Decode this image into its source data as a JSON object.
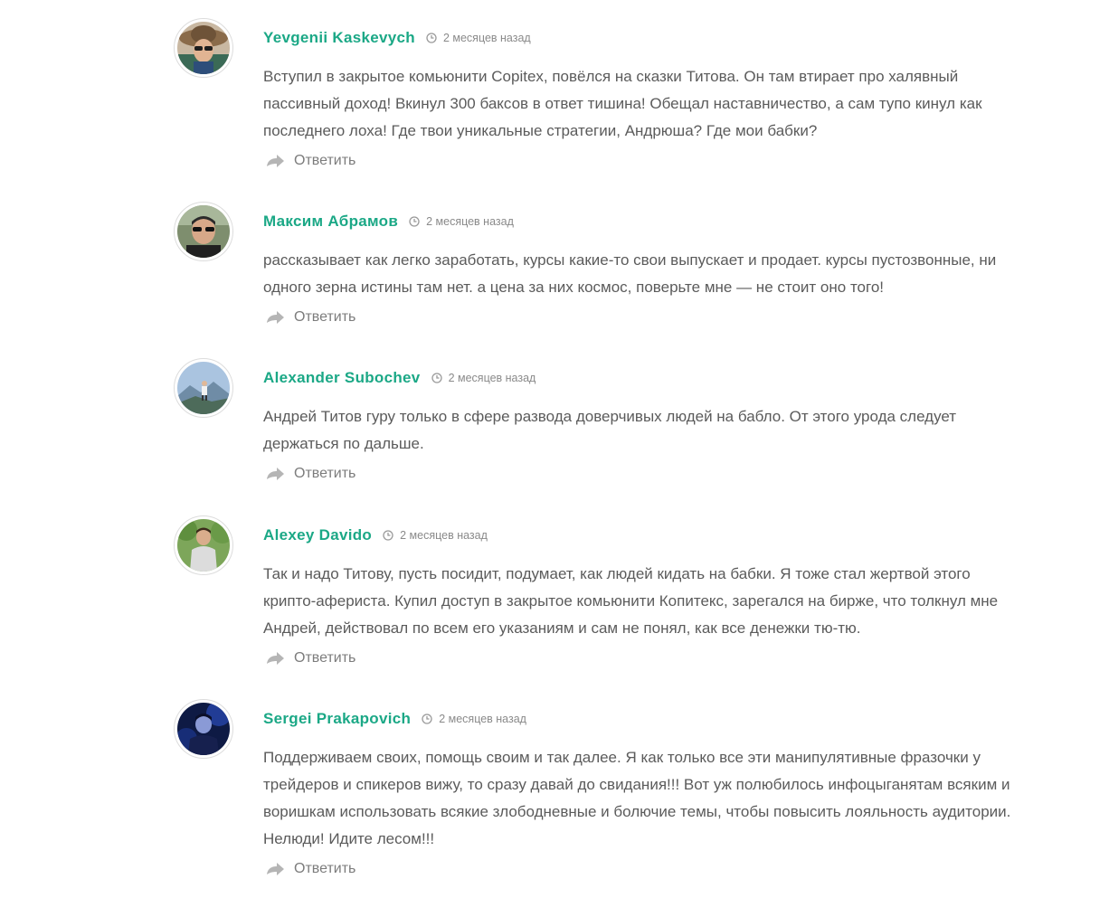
{
  "comments": [
    {
      "author": "Yevgenii Kaskevych",
      "date": "2 месяцев назад",
      "text": "Вступил в закрытое комьюнити Copitex, повёлся на сказки Титова. Он там втирает про халявный пассивный доход! Вкинул 300 баксов в ответ тишина! Обещал наставничество, а сам тупо кинул как последнего лоха! Где твои уникальные стратегии, Андрюша? Где мои бабки?",
      "reply_label": "Ответить",
      "avatar_icon": "avatar-man-hat-sunglasses"
    },
    {
      "author": "Максим Абрамов",
      "date": "2 месяцев назад",
      "text": "рассказывает как легко заработать, курсы какие-то свои выпускает и продает. курсы пустозвонные, ни одного зерна истины там нет. а цена за них космос, поверьте мне — не стоит оно того!",
      "reply_label": "Ответить",
      "avatar_icon": "avatar-man-sunglasses"
    },
    {
      "author": "Alexander Subochev",
      "date": "2 месяцев назад",
      "text": "Андрей Титов гуру только в сфере развода доверчивых людей на бабло. От этого урода следует держаться по дальше.",
      "reply_label": "Ответить",
      "avatar_icon": "avatar-person-mountains"
    },
    {
      "author": "Alexey Davido",
      "date": "2 месяцев назад",
      "text": "Так и надо Титову, пусть посидит, подумает, как людей кидать на бабки. Я тоже стал жертвой этого крипто-афериста. Купил доступ в закрытое комьюнити Копитекс, зарегался на бирже, что толкнул мне Андрей, действовал по всем его указаниям и сам не понял, как все денежки тю-тю.",
      "reply_label": "Ответить",
      "avatar_icon": "avatar-man-greenery"
    },
    {
      "author": "Sergei Prakapovich",
      "date": "2 месяцев назад",
      "text": "Поддерживаем своих, помощь своим и так далее. Я как только все эти манипулятивные фразочки у трейдеров и спикеров вижу, то сразу давай до свидания!!! Вот уж полюбилось инфоцыганятам всяким и воришкам использовать всякие злободневные и болючие темы, чтобы повысить лояльность аудитории. Нелюди! Идите лесом!!!",
      "reply_label": "Ответить",
      "avatar_icon": "avatar-man-blue-light"
    }
  ],
  "colors": {
    "author": "#1ba886",
    "text": "#5b5b5b",
    "meta": "#8a8a8a",
    "reply": "#7c7c7c",
    "reply_icon": "#b5b5b5"
  }
}
